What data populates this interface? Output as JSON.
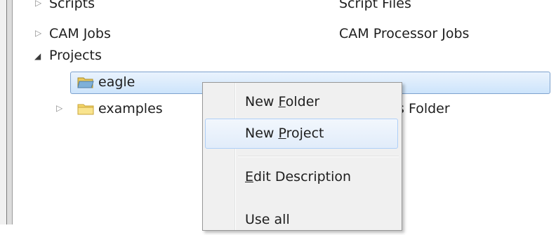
{
  "tree": {
    "rows": [
      {
        "label": "Scripts",
        "description": "Script Files"
      },
      {
        "label": "CAM Jobs",
        "description": "CAM Processor Jobs"
      },
      {
        "label": "Projects",
        "description": ""
      }
    ],
    "projects": [
      {
        "label": "eagle",
        "description": ""
      },
      {
        "label": "examples",
        "description": "s Folder"
      }
    ]
  },
  "context_menu": {
    "items": [
      {
        "pre": "New ",
        "accel": "F",
        "post": "older"
      },
      {
        "pre": "New ",
        "accel": "P",
        "post": "roject"
      },
      {
        "pre": "",
        "accel": "E",
        "post": "dit Description"
      },
      {
        "pre": "Use all",
        "accel": "",
        "post": ""
      }
    ]
  },
  "icons": {
    "collapsed": "triangle-right-icon",
    "expanded": "triangle-down-icon",
    "folder": "folder-icon"
  },
  "colors": {
    "selection_border": "#7da2ce",
    "hover_border": "#aecff7",
    "folder": "#f4d668"
  }
}
